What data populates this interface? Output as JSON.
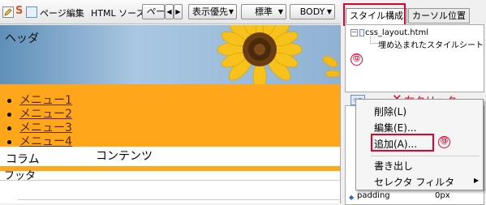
{
  "toolbar": {
    "s_icon": "S",
    "page_edit": "ページ編集",
    "html_source": "HTML ソース",
    "preview_cut": "ペー",
    "display_priority": "表示優先",
    "standard": "標準",
    "body": "BODY"
  },
  "page": {
    "header": "ヘッダ",
    "menu": [
      "メニュー1",
      "メニュー2",
      "メニュー3",
      "メニュー4"
    ],
    "column": "コラム",
    "content": "コンテンツ",
    "footer": "フッタ"
  },
  "panel": {
    "tab_style": "スタイル構成",
    "tab_cursor": "カーソル位置",
    "tree_root": "css_layout.html",
    "tree_child": "埋め込まれたスタイルシート",
    "annotation_12": "⑫",
    "annotation_right_click": "右クリック",
    "prop_name": "padding",
    "prop_value": "0px"
  },
  "context_menu": {
    "items": [
      "削除(L)",
      "編集(E)...",
      "追加(A)...",
      "書き出し",
      "セレクタ フィルタ"
    ],
    "annotation_13": "⑬"
  },
  "colors": {
    "accent_red": "#e3002b",
    "menu_orange": "#ffa61a"
  }
}
